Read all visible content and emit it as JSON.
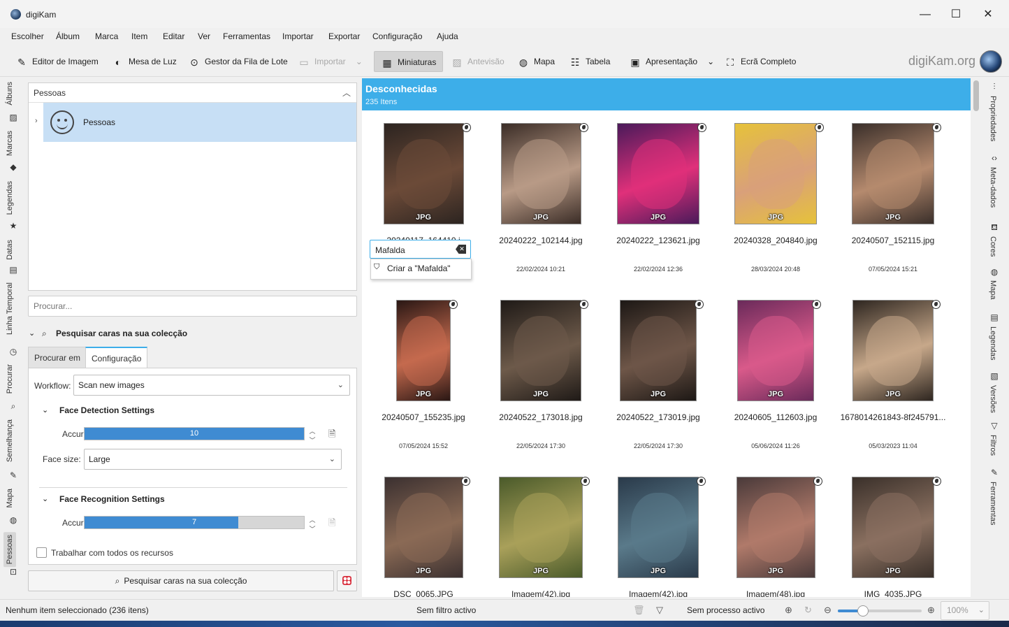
{
  "window": {
    "title": "digiKam",
    "controls": [
      "—",
      "☐",
      "✕"
    ]
  },
  "menu": [
    "Escolher",
    "Álbum",
    "Marca",
    "Item",
    "Editar",
    "Ver",
    "Ferramentas",
    "Importar",
    "Exportar",
    "Configuração",
    "Ajuda"
  ],
  "toolbar": {
    "image_editor": "Editor de Imagem",
    "light_table": "Mesa de Luz",
    "batch_queue": "Gestor da Fila de Lote",
    "import": "Importar",
    "thumbnails": "Miniaturas",
    "preview": "Antevisão",
    "map": "Mapa",
    "table": "Tabela",
    "slideshow": "Apresentação",
    "fullscreen": "Ecrã Completo",
    "brand": "digiKam.org"
  },
  "left_tabs": [
    "Álbuns",
    "Marcas",
    "Legendas",
    "Datas",
    "Linha Temporal",
    "Procurar",
    "Semelhança",
    "Mapa",
    "Pessoas"
  ],
  "right_tabs": [
    "Propriedades",
    "Meta-dados",
    "Cores",
    "Mapa",
    "Legendas",
    "Versões",
    "Filtros",
    "Ferramentas"
  ],
  "people_panel": {
    "header": "Pessoas",
    "tree_item": "Pessoas",
    "search_placeholder": "Procurar..."
  },
  "face_scan": {
    "section_title": "Pesquisar caras na sua colecção",
    "tabs": [
      "Procurar em",
      "Configuração"
    ],
    "active_tab": "Configuração",
    "workflow_label": "Workflow:",
    "workflow_value": "Scan new images",
    "detection_title": "Face Detection Settings",
    "detection_accuracy_label": "Accuracy:",
    "detection_accuracy": 10,
    "detection_accuracy_max": 10,
    "face_size_label": "Face size:",
    "face_size_value": "Large",
    "recognition_title": "Face Recognition Settings",
    "recognition_accuracy_label": "Accuracy:",
    "recognition_accuracy": 7,
    "recognition_accuracy_max": 10,
    "all_resources_label": "Trabalhar com todos os recursos",
    "all_resources_checked": false,
    "scan_button": "Pesquisar caras na sua colecção"
  },
  "content": {
    "title": "Desconhecidas",
    "count": "235 Itens",
    "badge": "JPG",
    "rename_value": "Mafalda",
    "create_suggestion": "Criar a \"Mafalda\"",
    "partial_name_row1": "20240117_164410.j",
    "items": [
      {
        "name": "",
        "date": ""
      },
      {
        "name": "20240222_102144.jpg",
        "date": "22/02/2024 10:21"
      },
      {
        "name": "20240222_123621.jpg",
        "date": "22/02/2024 12:36"
      },
      {
        "name": "20240328_204840.jpg",
        "date": "28/03/2024 20:48"
      },
      {
        "name": "20240507_152115.jpg",
        "date": "07/05/2024 15:21"
      },
      {
        "name": "20240507_155235.jpg",
        "date": "07/05/2024 15:52"
      },
      {
        "name": "20240522_173018.jpg",
        "date": "22/05/2024 17:30"
      },
      {
        "name": "20240522_173019.jpg",
        "date": "22/05/2024 17:30"
      },
      {
        "name": "20240605_112603.jpg",
        "date": "05/06/2024 11:26"
      },
      {
        "name": "1678014261843-8f245791...",
        "date": "05/03/2023 11:04"
      },
      {
        "name": "DSC_0065.JPG",
        "date": ""
      },
      {
        "name": "Imagem(42).jpg",
        "date": ""
      },
      {
        "name": "Imagem(42).jpg",
        "date": ""
      },
      {
        "name": "Imagem(48).jpg",
        "date": ""
      },
      {
        "name": "IMG_4035.JPG",
        "date": ""
      }
    ]
  },
  "status": {
    "selection": "Nenhum item seleccionado (236 itens)",
    "filter": "Sem filtro activo",
    "process": "Sem processo activo",
    "zoom": "100%",
    "zoom_fraction": 0.3
  },
  "colors": {
    "accent": "#3daee9",
    "progress": "#3f8bd2",
    "selection": "#c7dff5"
  }
}
